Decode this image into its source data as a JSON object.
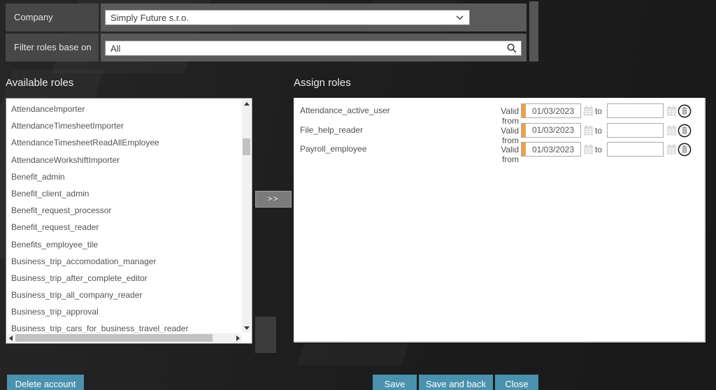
{
  "colors": {
    "accent_teal": "#4a92ad",
    "accent_orange": "#e9a24c",
    "panel_dark": "#474747",
    "panel_mid": "#5a5a5a"
  },
  "header": {
    "company_label": "Company",
    "company_value": "Simply Future s.r.o.",
    "filter_label": "Filter roles base on",
    "filter_value": "All"
  },
  "available": {
    "title": "Available roles",
    "items": [
      "AttendanceImporter",
      "AttendanceTimesheetImporter",
      "AttendanceTimesheetReadAllEmployee",
      "AttendanceWorkshiftImporter",
      "Benefit_admin",
      "Benefit_client_admin",
      "Benefit_request_processor",
      "Benefit_request_reader",
      "Benefits_employee_tile",
      "Business_trip_accomodation_manager",
      "Business_trip_after_complete_editor",
      "Business_trip_all_company_reader",
      "Business_trip_approval",
      "Business_trip_cars_for_business_travel_reader"
    ]
  },
  "move_button_label": ">>",
  "assign": {
    "title": "Assign roles",
    "valid_from_label": "Valid from",
    "to_label": "to",
    "rows": [
      {
        "name": "Attendance_active_user",
        "from": "01/03/2023",
        "to": ""
      },
      {
        "name": "File_help_reader",
        "from": "01/03/2023",
        "to": ""
      },
      {
        "name": "Payroll_employee",
        "from": "01/03/2023",
        "to": ""
      }
    ]
  },
  "footer": {
    "delete_label": "Delete account",
    "save_label": "Save",
    "save_back_label": "Save and back",
    "close_label": "Close"
  }
}
